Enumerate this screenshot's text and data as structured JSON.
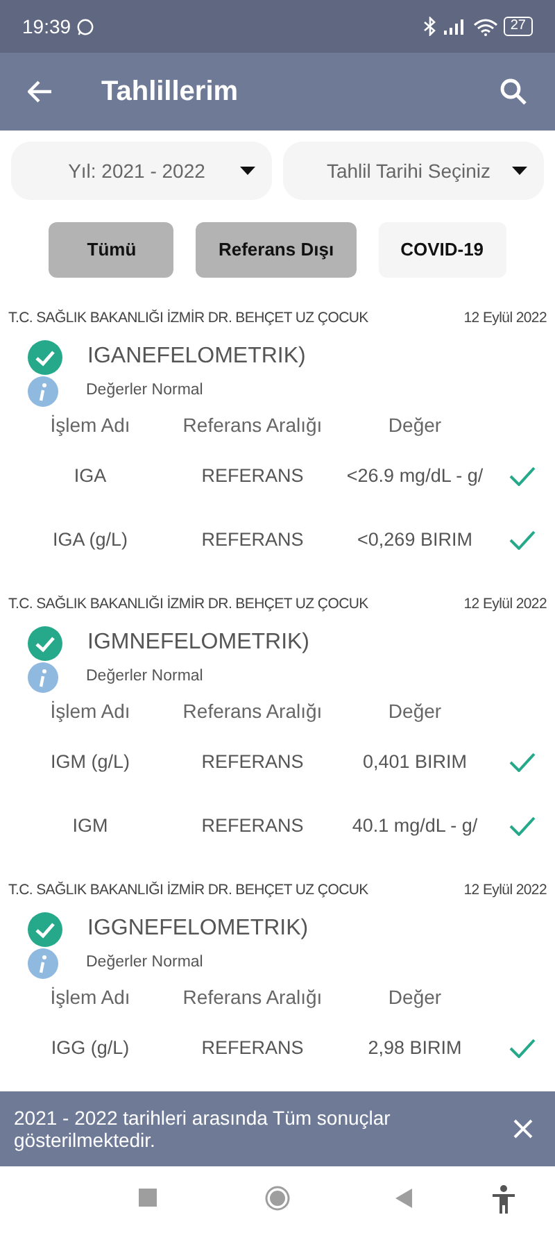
{
  "status_bar": {
    "time": "19:39",
    "battery": "27"
  },
  "app_bar": {
    "title": "Tahlillerim"
  },
  "dropdowns": [
    {
      "value": "Yıl: 2021 - 2022"
    },
    {
      "value": "Tahlil Tarihi Seçiniz"
    }
  ],
  "filters": [
    {
      "label": "Tümü",
      "selected": true
    },
    {
      "label": "Referans Dışı",
      "selected": true
    },
    {
      "label": "COVID-19",
      "selected": false
    }
  ],
  "results": [
    {
      "hospital": "T.C. SAĞLIK BAKANLIĞI İZMİR DR. BEHÇET UZ ÇOCUK",
      "date": "12 Eylül 2022",
      "test": "IGANEFELOMETRIK)",
      "normal": true,
      "note": "Değerler Normal",
      "columns": [
        "İşlem Adı",
        "Referans Aralığı",
        "Değer"
      ],
      "rows": [
        {
          "name": "IGA",
          "reference": "REFERANS",
          "value": "<26.9 mg/dL - g/",
          "normal": true
        },
        {
          "name": "IGA (g/L)",
          "reference": "REFERANS",
          "value": "<0,269 BIRIM",
          "normal": true
        }
      ]
    },
    {
      "hospital": "T.C. SAĞLIK BAKANLIĞI İZMİR DR. BEHÇET UZ ÇOCUK",
      "date": "12 Eylül 2022",
      "test": "IGMNEFELOMETRIK)",
      "normal": true,
      "note": "Değerler Normal",
      "columns": [
        "İşlem Adı",
        "Referans Aralığı",
        "Değer"
      ],
      "rows": [
        {
          "name": "IGM (g/L)",
          "reference": "REFERANS",
          "value": "0,401 BIRIM",
          "normal": true
        },
        {
          "name": "IGM",
          "reference": "REFERANS",
          "value": "40.1 mg/dL - g/",
          "normal": true
        }
      ]
    },
    {
      "hospital": "T.C. SAĞLIK BAKANLIĞI İZMİR DR. BEHÇET UZ ÇOCUK",
      "date": "12 Eylül 2022",
      "test": "IGGNEFELOMETRIK)",
      "normal": true,
      "note": "Değerler Normal",
      "columns": [
        "İşlem Adı",
        "Referans Aralığı",
        "Değer"
      ],
      "rows": [
        {
          "name": "IGG (g/L)",
          "reference": "REFERANS",
          "value": "2,98 BIRIM",
          "normal": true
        }
      ]
    }
  ],
  "snackbar": {
    "message": "2021 - 2022 tarihleri arasında Tüm sonuçlar gösterilmektedir."
  }
}
